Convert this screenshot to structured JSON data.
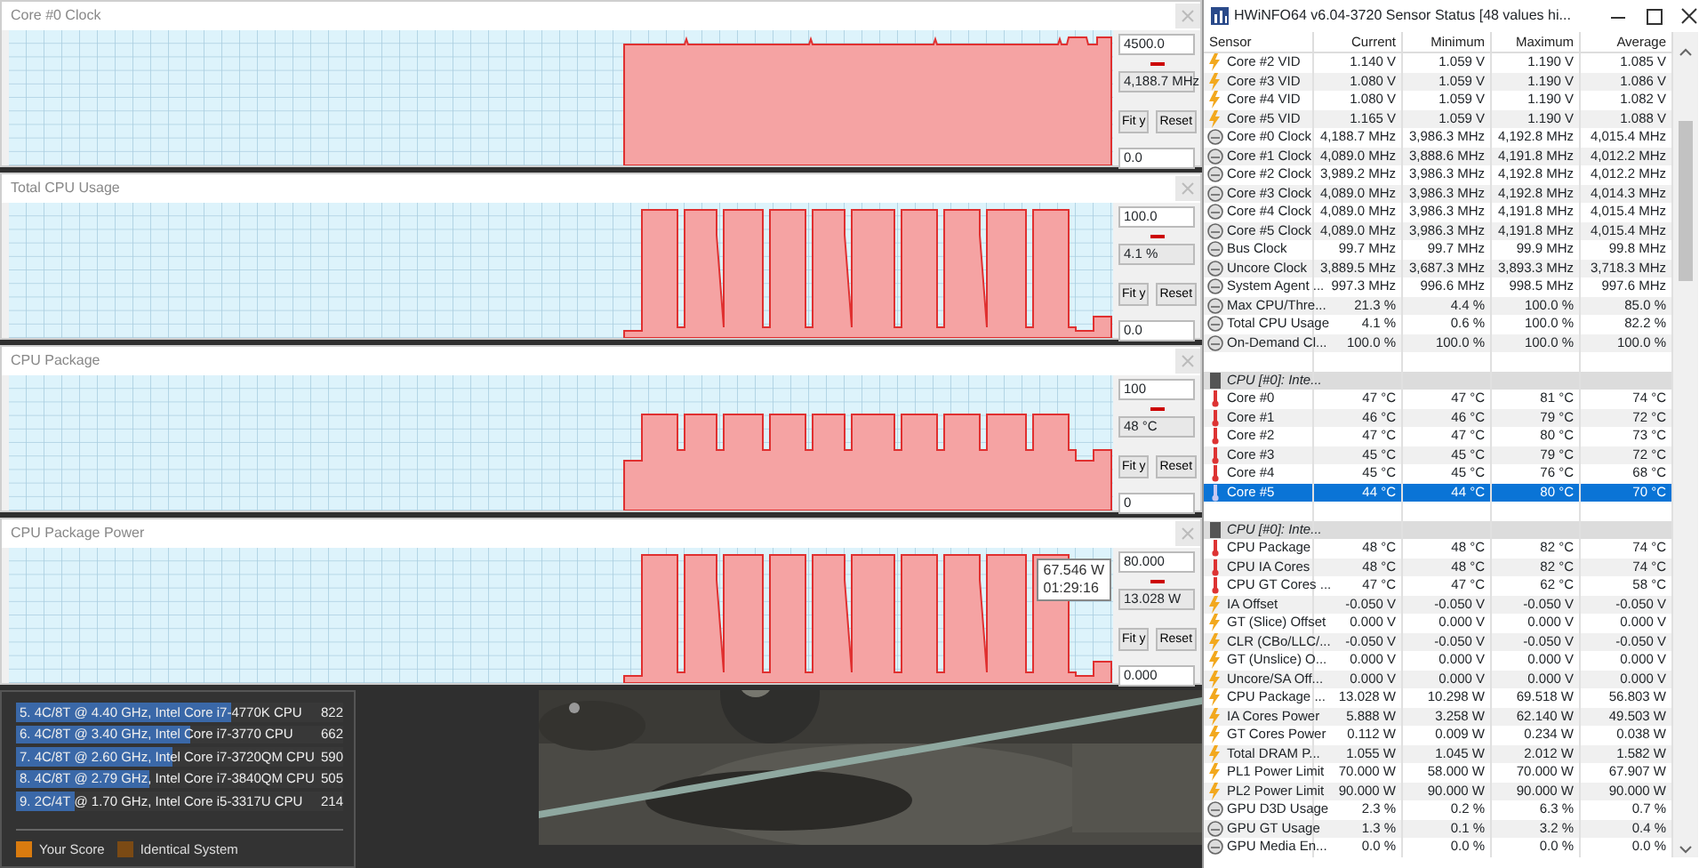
{
  "graphs": [
    {
      "title": "Core #0 Clock",
      "kind": "steady",
      "max": "4500.0",
      "current": "4,188.7 MHz",
      "min": "0.0",
      "buttons": [
        "Fit y",
        "Reset"
      ]
    },
    {
      "title": "Total CPU Usage",
      "kind": "pulsed-deep",
      "max": "100.0",
      "current": "4.1 %",
      "min": "0.0",
      "buttons": [
        "Fit y",
        "Reset"
      ]
    },
    {
      "title": "CPU Package",
      "kind": "pulsed-shallow",
      "max": "100",
      "current": "48 °C",
      "min": "0",
      "buttons": [
        "Fit y",
        "Reset"
      ]
    },
    {
      "title": "CPU Package Power",
      "kind": "pulsed-deep",
      "max": "80.000",
      "current": "13.028 W",
      "min": "0.000",
      "buttons": [
        "Fit y",
        "Reset"
      ],
      "tooltip": {
        "value": "67.546 W",
        "time": "01:29:16"
      }
    }
  ],
  "ranking": {
    "items": [
      {
        "label": "5. 4C/8T @ 4.40 GHz, Intel Core i7-4770K CPU",
        "score": "822",
        "level": 0.66
      },
      {
        "label": "6. 4C/8T @ 3.40 GHz, Intel Core i7-3770 CPU",
        "score": "662",
        "level": 0.53
      },
      {
        "label": "7. 4C/8T @ 2.60 GHz, Intel Core i7-3720QM CPU",
        "score": "590",
        "level": 0.48
      },
      {
        "label": "8. 4C/8T @ 2.79 GHz, Intel Core i7-3840QM CPU",
        "score": "505",
        "level": 0.41
      },
      {
        "label": "9. 2C/4T @ 1.70 GHz, Intel Core i5-3317U CPU",
        "score": "214",
        "level": 0.18
      }
    ],
    "legend": [
      {
        "label": "Your Score",
        "color": "#d97b0f"
      },
      {
        "label": "Identical System",
        "color": "#7b4a14"
      }
    ]
  },
  "hwinfo": {
    "title": "HWiNFO64 v6.04-3720 Sensor Status [48 values hi...",
    "columns": [
      "Sensor",
      "Current",
      "Minimum",
      "Maximum",
      "Average"
    ],
    "rows": [
      {
        "kind": "bolt",
        "name": "Core #2 VID",
        "values": [
          "1.140 V",
          "1.059 V",
          "1.190 V",
          "1.085 V"
        ],
        "selected": false
      },
      {
        "kind": "bolt",
        "name": "Core #3 VID",
        "values": [
          "1.080 V",
          "1.059 V",
          "1.190 V",
          "1.086 V"
        ],
        "selected": false
      },
      {
        "kind": "bolt",
        "name": "Core #4 VID",
        "values": [
          "1.080 V",
          "1.059 V",
          "1.190 V",
          "1.082 V"
        ],
        "selected": false
      },
      {
        "kind": "bolt",
        "name": "Core #5 VID",
        "values": [
          "1.165 V",
          "1.059 V",
          "1.190 V",
          "1.088 V"
        ],
        "selected": false
      },
      {
        "kind": "gauge",
        "name": "Core #0 Clock",
        "values": [
          "4,188.7 MHz",
          "3,986.3 MHz",
          "4,192.8 MHz",
          "4,015.4 MHz"
        ],
        "selected": false
      },
      {
        "kind": "gauge",
        "name": "Core #1 Clock",
        "values": [
          "4,089.0 MHz",
          "3,888.6 MHz",
          "4,191.8 MHz",
          "4,012.2 MHz"
        ],
        "selected": false
      },
      {
        "kind": "gauge",
        "name": "Core #2 Clock",
        "values": [
          "3,989.2 MHz",
          "3,986.3 MHz",
          "4,192.8 MHz",
          "4,012.2 MHz"
        ],
        "selected": false
      },
      {
        "kind": "gauge",
        "name": "Core #3 Clock",
        "values": [
          "4,089.0 MHz",
          "3,986.3 MHz",
          "4,192.8 MHz",
          "4,014.3 MHz"
        ],
        "selected": false
      },
      {
        "kind": "gauge",
        "name": "Core #4 Clock",
        "values": [
          "4,089.0 MHz",
          "3,986.3 MHz",
          "4,191.8 MHz",
          "4,015.4 MHz"
        ],
        "selected": false
      },
      {
        "kind": "gauge",
        "name": "Core #5 Clock",
        "values": [
          "4,089.0 MHz",
          "3,986.3 MHz",
          "4,191.8 MHz",
          "4,015.4 MHz"
        ],
        "selected": false
      },
      {
        "kind": "gauge",
        "name": "Bus Clock",
        "values": [
          "99.7 MHz",
          "99.7 MHz",
          "99.9 MHz",
          "99.8 MHz"
        ],
        "selected": false
      },
      {
        "kind": "gauge",
        "name": "Uncore Clock",
        "values": [
          "3,889.5 MHz",
          "3,687.3 MHz",
          "3,893.3 MHz",
          "3,718.3 MHz"
        ],
        "selected": false
      },
      {
        "kind": "gauge",
        "name": "System Agent ...",
        "values": [
          "997.3 MHz",
          "996.6 MHz",
          "998.5 MHz",
          "997.6 MHz"
        ],
        "selected": false
      },
      {
        "kind": "gauge",
        "name": "Max CPU/Thre...",
        "values": [
          "21.3 %",
          "4.4 %",
          "100.0 %",
          "85.0 %"
        ],
        "selected": false
      },
      {
        "kind": "gauge",
        "name": "Total CPU Usage",
        "values": [
          "4.1 %",
          "0.6 %",
          "100.0 %",
          "82.2 %"
        ],
        "selected": false
      },
      {
        "kind": "gauge",
        "name": "On-Demand Cl...",
        "values": [
          "100.0 %",
          "100.0 %",
          "100.0 %",
          "100.0 %"
        ],
        "selected": false
      },
      {
        "kind": "blank"
      },
      {
        "kind": "group",
        "name": "CPU [#0]: Inte...",
        "selected": false
      },
      {
        "kind": "thermo",
        "name": "Core #0",
        "values": [
          "47 °C",
          "47 °C",
          "81 °C",
          "74 °C"
        ],
        "selected": false
      },
      {
        "kind": "thermo",
        "name": "Core #1",
        "values": [
          "46 °C",
          "46 °C",
          "79 °C",
          "72 °C"
        ],
        "selected": false
      },
      {
        "kind": "thermo",
        "name": "Core #2",
        "values": [
          "47 °C",
          "47 °C",
          "80 °C",
          "73 °C"
        ],
        "selected": false
      },
      {
        "kind": "thermo",
        "name": "Core #3",
        "values": [
          "45 °C",
          "45 °C",
          "79 °C",
          "72 °C"
        ],
        "selected": false
      },
      {
        "kind": "thermo",
        "name": "Core #4",
        "values": [
          "45 °C",
          "45 °C",
          "76 °C",
          "68 °C"
        ],
        "selected": false
      },
      {
        "kind": "thermo",
        "name": "Core #5",
        "values": [
          "44 °C",
          "44 °C",
          "80 °C",
          "70 °C"
        ],
        "selected": true
      },
      {
        "kind": "blank"
      },
      {
        "kind": "group",
        "name": "CPU [#0]: Inte...",
        "selected": false
      },
      {
        "kind": "thermo",
        "name": "CPU Package",
        "values": [
          "48 °C",
          "48 °C",
          "82 °C",
          "74 °C"
        ],
        "selected": false
      },
      {
        "kind": "thermo",
        "name": "CPU IA Cores",
        "values": [
          "48 °C",
          "48 °C",
          "82 °C",
          "74 °C"
        ],
        "selected": false
      },
      {
        "kind": "thermo",
        "name": "CPU GT Cores ...",
        "values": [
          "47 °C",
          "47 °C",
          "62 °C",
          "58 °C"
        ],
        "selected": false
      },
      {
        "kind": "bolt",
        "name": "IA Offset",
        "values": [
          "-0.050 V",
          "-0.050 V",
          "-0.050 V",
          "-0.050 V"
        ],
        "selected": false
      },
      {
        "kind": "bolt",
        "name": "GT (Slice) Offset",
        "values": [
          "0.000 V",
          "0.000 V",
          "0.000 V",
          "0.000 V"
        ],
        "selected": false
      },
      {
        "kind": "bolt",
        "name": "CLR (CBo/LLC/...",
        "values": [
          "-0.050 V",
          "-0.050 V",
          "-0.050 V",
          "-0.050 V"
        ],
        "selected": false
      },
      {
        "kind": "bolt",
        "name": "GT (Unslice) O...",
        "values": [
          "0.000 V",
          "0.000 V",
          "0.000 V",
          "0.000 V"
        ],
        "selected": false
      },
      {
        "kind": "bolt",
        "name": "Uncore/SA Off...",
        "values": [
          "0.000 V",
          "0.000 V",
          "0.000 V",
          "0.000 V"
        ],
        "selected": false
      },
      {
        "kind": "bolt",
        "name": "CPU Package ...",
        "values": [
          "13.028 W",
          "10.298 W",
          "69.518 W",
          "56.803 W"
        ],
        "selected": false
      },
      {
        "kind": "bolt",
        "name": "IA Cores Power",
        "values": [
          "5.888 W",
          "3.258 W",
          "62.140 W",
          "49.503 W"
        ],
        "selected": false
      },
      {
        "kind": "bolt",
        "name": "GT Cores Power",
        "values": [
          "0.112 W",
          "0.009 W",
          "0.234 W",
          "0.038 W"
        ],
        "selected": false
      },
      {
        "kind": "bolt",
        "name": "Total DRAM P...",
        "values": [
          "1.055 W",
          "1.045 W",
          "2.012 W",
          "1.582 W"
        ],
        "selected": false
      },
      {
        "kind": "bolt",
        "name": "PL1 Power Limit",
        "values": [
          "70.000 W",
          "58.000 W",
          "70.000 W",
          "67.907 W"
        ],
        "selected": false
      },
      {
        "kind": "bolt",
        "name": "PL2 Power Limit",
        "values": [
          "90.000 W",
          "90.000 W",
          "90.000 W",
          "90.000 W"
        ],
        "selected": false
      },
      {
        "kind": "gauge",
        "name": "GPU D3D Usage",
        "values": [
          "2.3 %",
          "0.2 %",
          "6.3 %",
          "0.7 %"
        ],
        "selected": false
      },
      {
        "kind": "gauge",
        "name": "GPU GT Usage",
        "values": [
          "1.3 %",
          "0.1 %",
          "3.2 %",
          "0.4 %"
        ],
        "selected": false
      },
      {
        "kind": "gauge",
        "name": "GPU Media En...",
        "values": [
          "0.0 %",
          "0.0 %",
          "0.0 %",
          "0.0 %"
        ],
        "selected": false
      }
    ]
  }
}
